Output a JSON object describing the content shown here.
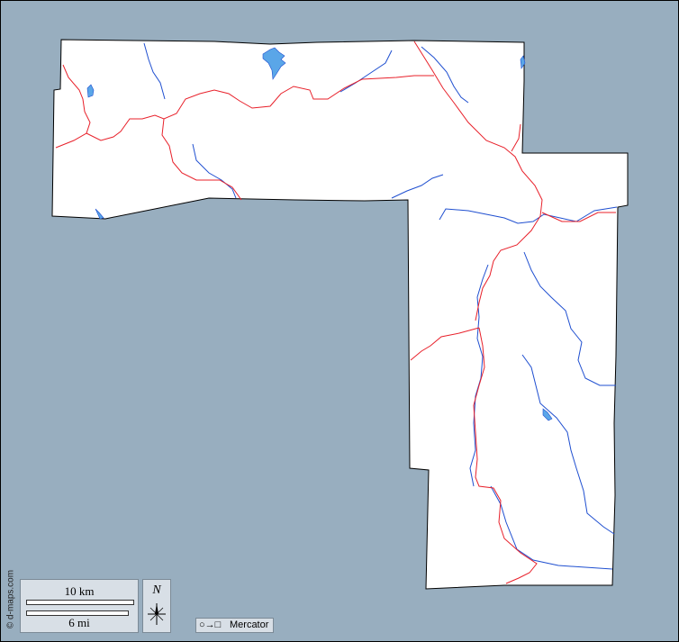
{
  "map": {
    "credit": "© d-maps.com",
    "scale": {
      "km_label": "10 km",
      "mi_label": "6 mi"
    },
    "north_label": "N",
    "projection": {
      "icon": "○→□",
      "label": "Mercator"
    },
    "colors": {
      "ocean": "#98aebf",
      "land": "#ffffff",
      "border": "#000000",
      "rivers": "#1f4fd0",
      "roads": "#e8202a",
      "lakes": "#5aa6e8"
    }
  }
}
